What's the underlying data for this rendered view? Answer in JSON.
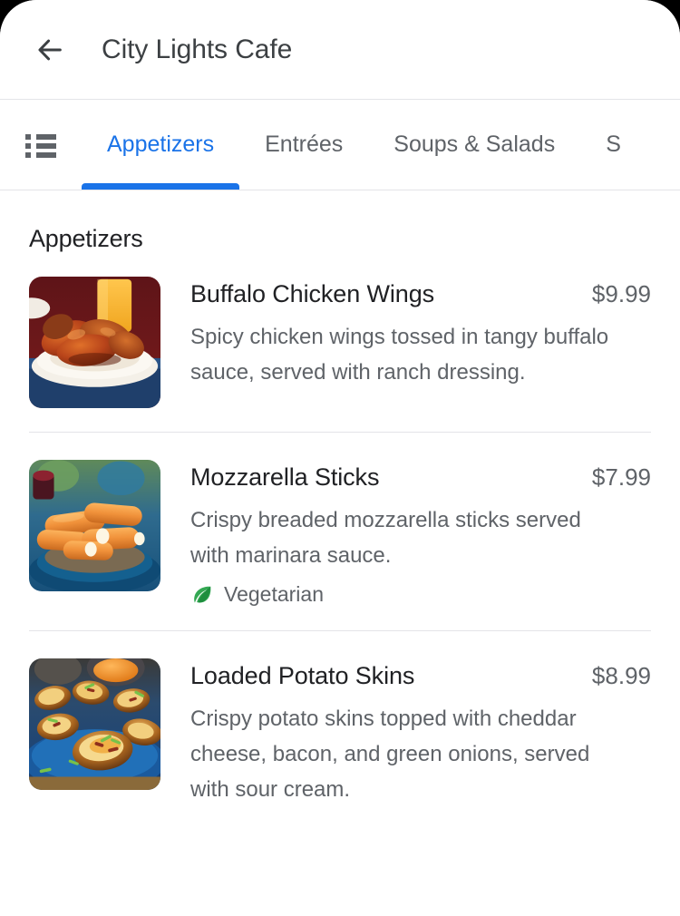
{
  "header": {
    "back_icon": "arrow-back-icon",
    "title": "City Lights Cafe"
  },
  "tabbar": {
    "list_icon": "list-menu-icon",
    "tabs": [
      {
        "label": "Appetizers",
        "active": true
      },
      {
        "label": "Entrées",
        "active": false
      },
      {
        "label": "Soups & Salads",
        "active": false
      },
      {
        "label": "S",
        "active": false
      }
    ],
    "active_color": "#1a73e8",
    "inactive_color": "#5f6368"
  },
  "section": {
    "title": "Appetizers"
  },
  "menu_items": [
    {
      "name": "Buffalo Chicken Wings",
      "price": "$9.99",
      "description": "Spicy chicken wings tossed in tangy buffalo sauce, served with ranch dressing.",
      "image_alt": "buffalo-chicken-wings-photo",
      "tag": null
    },
    {
      "name": "Mozzarella Sticks",
      "price": "$7.99",
      "description": "Crispy breaded mozzarella sticks served with marinara sauce.",
      "image_alt": "mozzarella-sticks-photo",
      "tag": {
        "label": "Vegetarian",
        "icon": "leaf-icon",
        "color": "#34a853"
      }
    },
    {
      "name": "Loaded Potato Skins",
      "price": "$8.99",
      "description": "Crispy potato skins topped with cheddar cheese, bacon, and green onions, served with sour cream.",
      "image_alt": "loaded-potato-skins-photo",
      "tag": null
    }
  ]
}
